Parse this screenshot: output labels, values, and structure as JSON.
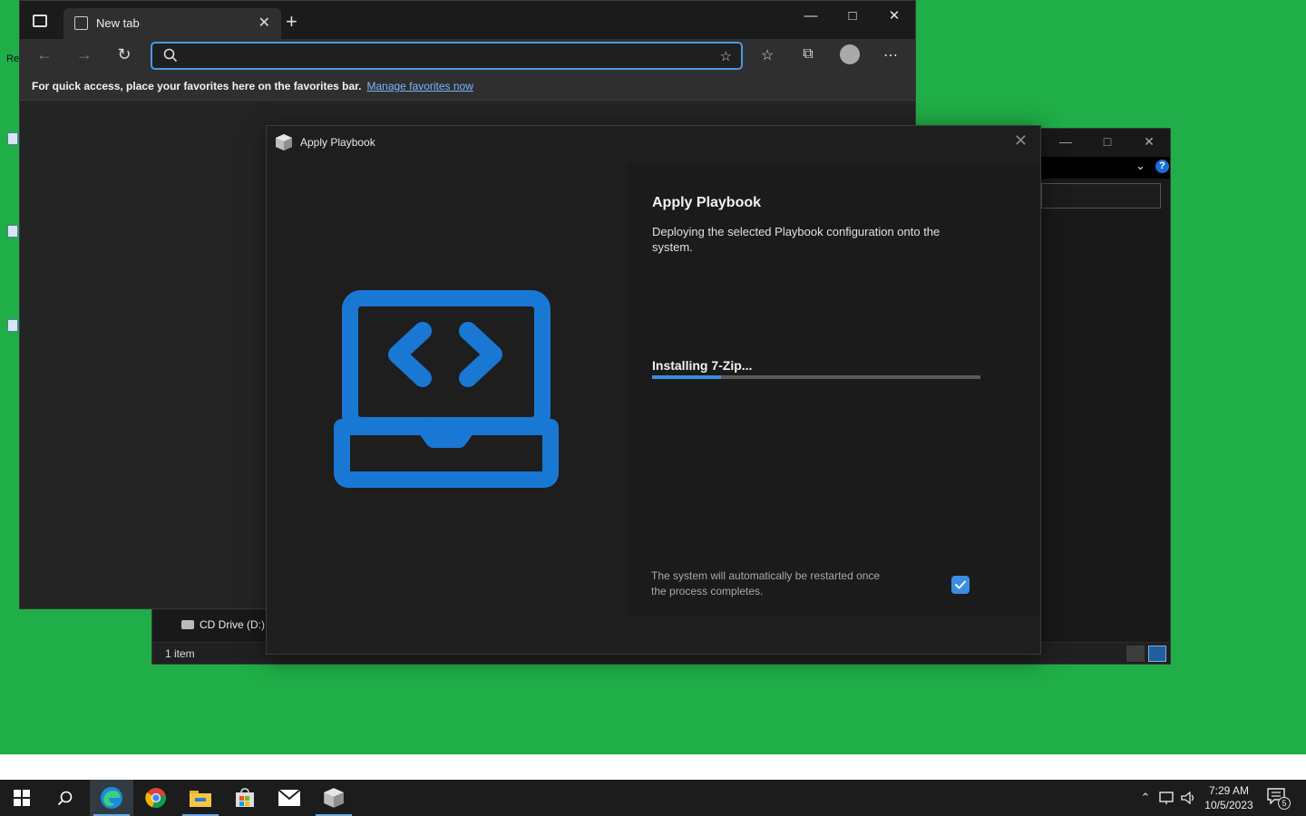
{
  "desktop": {
    "partial_label": "Re"
  },
  "browser": {
    "tab_title": "New tab",
    "address_placeholder": "",
    "favorites_message": "For quick access, place your favorites here on the favorites bar.",
    "favorites_link": "Manage favorites now"
  },
  "explorer": {
    "drive_item": "CD Drive (D:)",
    "status_items": "1 item"
  },
  "dialog": {
    "window_title": "Apply Playbook",
    "heading": "Apply Playbook",
    "description": "Deploying the selected Playbook configuration onto the system.",
    "status": "Installing 7-Zip...",
    "progress_fraction": 0.21,
    "restart_note": "The system will automatically be restarted once the process completes.",
    "restart_checked": true,
    "accent_color": "#3a8de0"
  },
  "taskbar": {
    "time": "7:29 AM",
    "date": "10/5/2023",
    "notification_count": "5"
  }
}
